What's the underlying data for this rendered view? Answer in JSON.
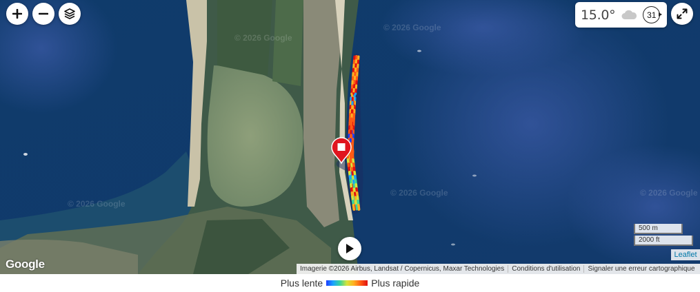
{
  "map": {
    "watermark_text": "© 2026 Google",
    "google_logo": "Google",
    "track_colors": [
      "#1e3dff",
      "#19a3ff",
      "#39d39a",
      "#d7e43a",
      "#ffb020",
      "#ff5a14",
      "#e01010"
    ],
    "marker_color": "#e0151e"
  },
  "controls": {
    "zoom_in_icon": "plus-icon",
    "zoom_out_icon": "minus-icon",
    "layers_icon": "layers-icon",
    "fullscreen_icon": "expand-icon",
    "play_icon": "play-icon"
  },
  "weather": {
    "temperature": "15.0°",
    "condition_icon": "cloud-icon",
    "wind_speed": "31"
  },
  "scale": {
    "metric": "500 m",
    "imperial": "2000 ft"
  },
  "attribution": {
    "leaflet": "Leaflet",
    "imagery": "Imagerie ©2026 Airbus, Landsat / Copernicus, Maxar Technologies",
    "terms": "Conditions d'utilisation",
    "report": "Signaler une erreur cartographique"
  },
  "legend": {
    "slow_label": "Plus lente",
    "fast_label": "Plus rapide"
  }
}
